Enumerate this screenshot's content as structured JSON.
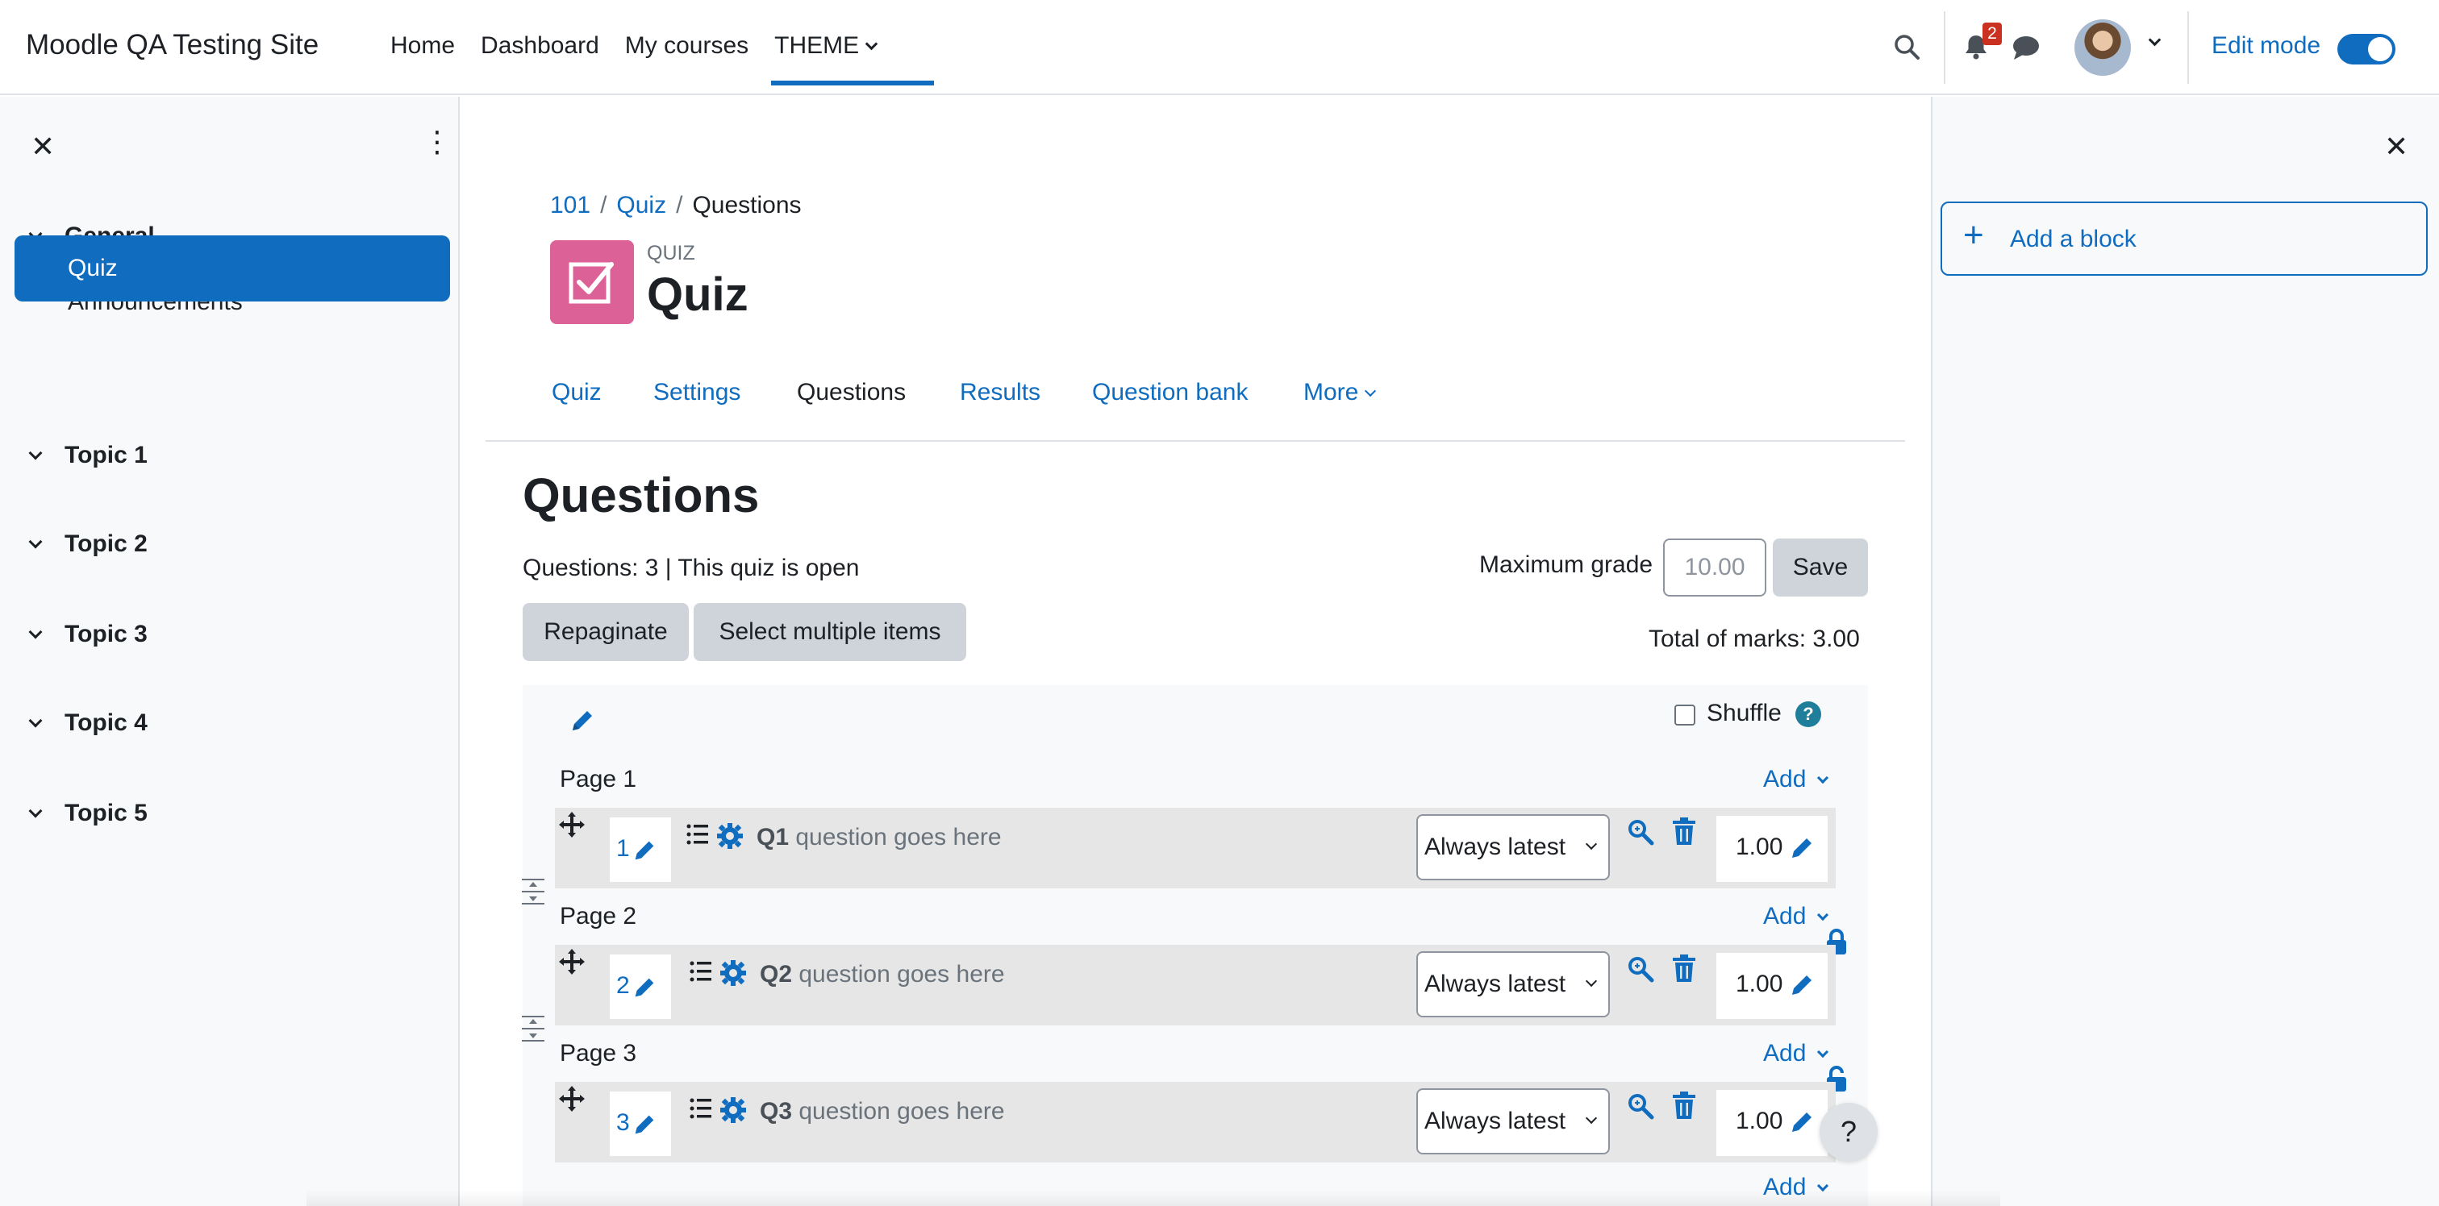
{
  "site_name": "Moodle QA Testing Site",
  "primary_nav": [
    "Home",
    "Dashboard",
    "My courses",
    "THEME"
  ],
  "notifications_count": "2",
  "edit_mode_label": "Edit mode",
  "edit_mode_on": true,
  "course_index": {
    "sections": [
      {
        "label": "General",
        "items": [
          "Announcements",
          "Quiz"
        ]
      },
      {
        "label": "Topic 1"
      },
      {
        "label": "Topic 2"
      },
      {
        "label": "Topic 3"
      },
      {
        "label": "Topic 4"
      },
      {
        "label": "Topic 5"
      }
    ],
    "active_item": "Quiz"
  },
  "add_block": {
    "label": "Add a block",
    "icon": "plus-icon"
  },
  "breadcrumb": [
    "101",
    "Quiz",
    "Questions"
  ],
  "activity": {
    "type_label": "QUIZ",
    "title": "Quiz",
    "icon_color": "#dc6197"
  },
  "tabs": [
    "Quiz",
    "Settings",
    "Questions",
    "Results",
    "Question bank",
    "More"
  ],
  "active_tab": "Questions",
  "page": {
    "heading": "Questions",
    "status": "Questions: 3 | This quiz is open",
    "repaginate_label": "Repaginate",
    "select_multiple_label": "Select multiple items",
    "max_grade_label": "Maximum grade",
    "max_grade_value": "10.00",
    "save_label": "Save",
    "total_marks": "Total of marks: 3.00",
    "shuffle_label": "Shuffle",
    "help_glyph": "?",
    "add_label": "Add",
    "pages": [
      {
        "label": "Page 1",
        "slot": {
          "num": "1",
          "qname": "Q1",
          "qtext": "question goes here",
          "version": "Always latest",
          "mark": "1.00"
        }
      },
      {
        "label": "Page 2",
        "slot": {
          "num": "2",
          "qname": "Q2",
          "qtext": "question goes here",
          "version": "Always latest",
          "mark": "1.00"
        }
      },
      {
        "label": "Page 3",
        "slot": {
          "num": "3",
          "qname": "Q3",
          "qtext": "question goes here",
          "version": "Always latest",
          "mark": "1.00"
        }
      }
    ]
  },
  "colors": {
    "brand": "#0f6cbf",
    "badge": "#ca3120",
    "help": "#1f7e9a"
  }
}
